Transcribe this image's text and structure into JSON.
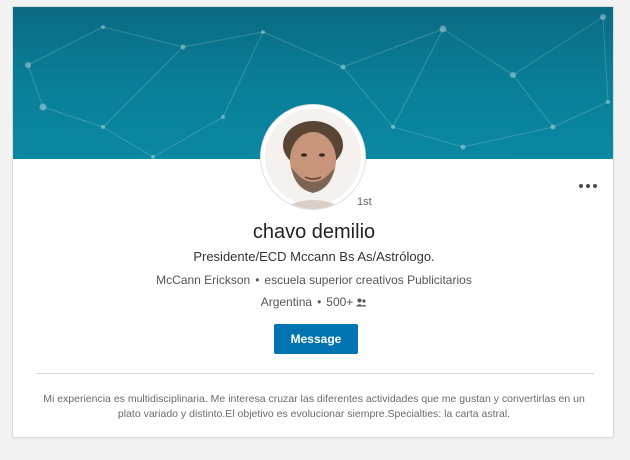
{
  "profile": {
    "name": "chavo demilio",
    "degree": "1st",
    "headline": "Presidente/ECD Mccann Bs As/Astrólogo.",
    "company": "McCann Erickson",
    "school": "escuela superior creativos Publicitarios",
    "location": "Argentina",
    "connections": "500+",
    "summary": "Mi experiencia es multidisciplinaria. Me interesa cruzar las diferentes actividades que me gustan y convertirlas en un plato variado y distinto.El objetivo es evolucionar siempre.Specialties: la carta astral."
  },
  "actions": {
    "message_label": "Message",
    "more_icon": "more-horizontal-icon"
  },
  "icons": {
    "connections": "connections-icon"
  },
  "colors": {
    "banner": "#0a7d96",
    "primary_button": "#0073b1",
    "background": "#f3f3f3"
  }
}
